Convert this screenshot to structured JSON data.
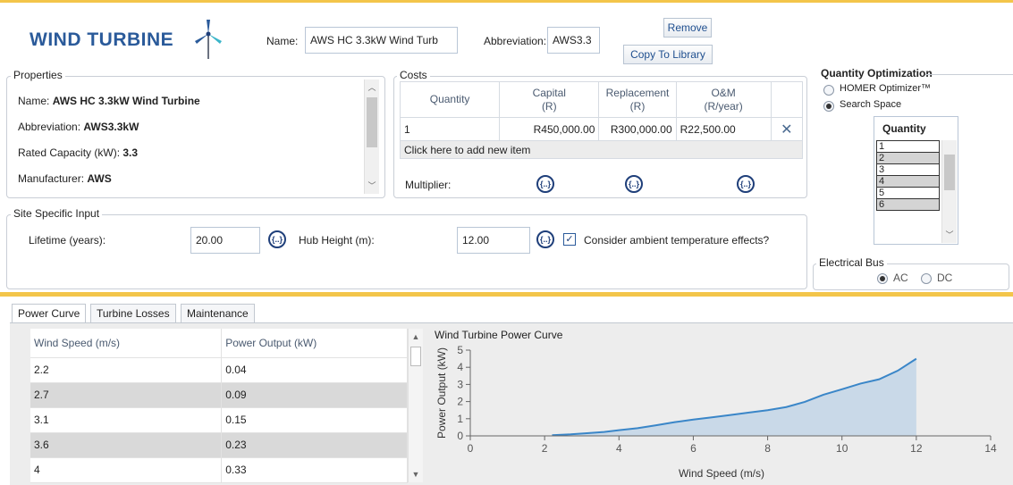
{
  "header": {
    "title": "WIND TURBINE",
    "name_label": "Name:",
    "name_value": "AWS HC 3.3kW Wind Turb",
    "abbr_label": "Abbreviation:",
    "abbr_value": "AWS3.3",
    "remove_label": "Remove",
    "copy_label": "Copy To Library"
  },
  "properties": {
    "legend": "Properties",
    "rows": [
      {
        "label": "Name: ",
        "value": "AWS HC 3.3kW Wind Turbine"
      },
      {
        "label": "Abbreviation: ",
        "value": "AWS3.3kW"
      },
      {
        "label": "Rated Capacity (kW): ",
        "value": "3.3"
      },
      {
        "label": "Manufacturer: ",
        "value": "AWS"
      }
    ]
  },
  "costs": {
    "legend": "Costs",
    "headers": [
      {
        "l1": "Quantity",
        "l2": ""
      },
      {
        "l1": "Capital",
        "l2": "(R)"
      },
      {
        "l1": "Replacement",
        "l2": "(R)"
      },
      {
        "l1": "O&M",
        "l2": "(R/year)"
      }
    ],
    "row": {
      "quantity": "1",
      "capital": "R450,000.00",
      "replacement": "R300,000.00",
      "om": "R22,500.00"
    },
    "add_item": "Click here to add new item",
    "multiplier_label": "Multiplier:",
    "fx_symbol": "{..}"
  },
  "site": {
    "legend": "Site Specific Input",
    "lifetime_label": "Lifetime (years):",
    "lifetime_value": "20.00",
    "hub_label": "Hub Height (m):",
    "hub_value": "12.00",
    "ambient_label": "Consider ambient temperature effects?",
    "ambient_checked": true
  },
  "optimization": {
    "title": "Quantity Optimization",
    "opt1": "HOMER Optimizer™",
    "opt2": "Search Space",
    "selected": "Search Space",
    "table_header": "Quantity",
    "values": [
      "1",
      "2",
      "3",
      "4",
      "5",
      "6"
    ]
  },
  "bus": {
    "legend": "Electrical Bus",
    "ac": "AC",
    "dc": "DC",
    "selected": "AC"
  },
  "tabs": [
    {
      "label": "Power Curve",
      "active": true
    },
    {
      "label": "Turbine Losses",
      "active": false
    },
    {
      "label": "Maintenance",
      "active": false
    }
  ],
  "power_table": {
    "col1": "Wind Speed (m/s)",
    "col2": "Power Output (kW)",
    "rows": [
      [
        "2.2",
        "0.04"
      ],
      [
        "2.7",
        "0.09"
      ],
      [
        "3.1",
        "0.15"
      ],
      [
        "3.6",
        "0.23"
      ],
      [
        "4",
        "0.33"
      ]
    ]
  },
  "chart_data": {
    "type": "area",
    "title": "Wind Turbine Power Curve",
    "xlabel": "Wind Speed (m/s)",
    "ylabel": "Power Output (kW)",
    "xlim": [
      0,
      14
    ],
    "ylim": [
      0,
      5
    ],
    "xticks": [
      0,
      2,
      4,
      6,
      8,
      10,
      12,
      14
    ],
    "yticks": [
      0,
      1,
      2,
      3,
      4,
      5
    ],
    "x": [
      2.2,
      2.7,
      3.1,
      3.6,
      4,
      4.5,
      5,
      5.5,
      6,
      6.5,
      7,
      7.5,
      8,
      8.5,
      9,
      9.5,
      10,
      10.5,
      11,
      11.5,
      12
    ],
    "y": [
      0.04,
      0.09,
      0.15,
      0.23,
      0.33,
      0.45,
      0.62,
      0.8,
      0.95,
      1.08,
      1.22,
      1.36,
      1.5,
      1.68,
      1.98,
      2.4,
      2.72,
      3.05,
      3.3,
      3.8,
      4.5
    ],
    "color": "#3a86c8",
    "fill": "#c9d9e8"
  }
}
